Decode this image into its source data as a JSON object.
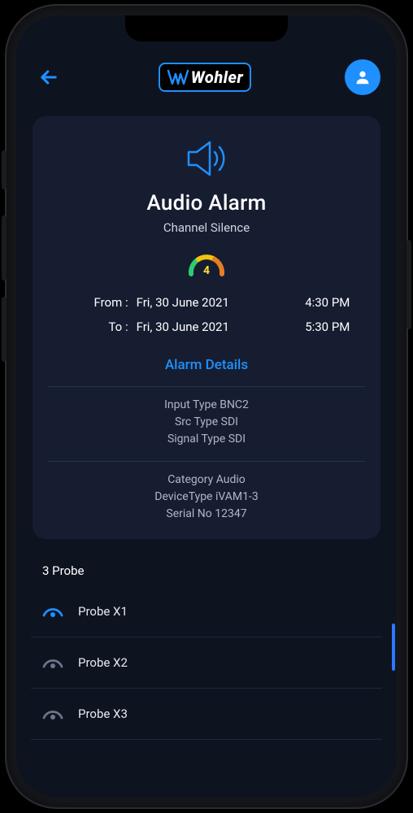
{
  "header": {
    "brand": "Wohler"
  },
  "alarm": {
    "title": "Audio Alarm",
    "subtitle": "Channel Silence",
    "severity": "4",
    "from_label": "From :",
    "to_label": "To   :",
    "from_date": "Fri, 30 June 2021",
    "from_time": "4:30 PM",
    "to_date": "Fri, 30 June 2021",
    "to_time": "5:30 PM",
    "details_header": "Alarm Details",
    "details1_line1": "Input Type BNC2",
    "details1_line2": "Src Type SDI",
    "details1_line3": "Signal Type SDI",
    "details2_line1": "Category Audio",
    "details2_line2": "DeviceType iVAM1-3",
    "details2_line3": "Serial No 12347"
  },
  "probes": {
    "count_label": "3 Probe",
    "items": [
      {
        "label": "Probe X1",
        "active": true
      },
      {
        "label": "Probe X2",
        "active": false
      },
      {
        "label": "Probe X3",
        "active": false
      }
    ]
  },
  "colors": {
    "accent": "#1e90ff",
    "gauge_low": "#2ecc71",
    "gauge_mid": "#f1c40f",
    "gauge_high": "#e67e22"
  }
}
